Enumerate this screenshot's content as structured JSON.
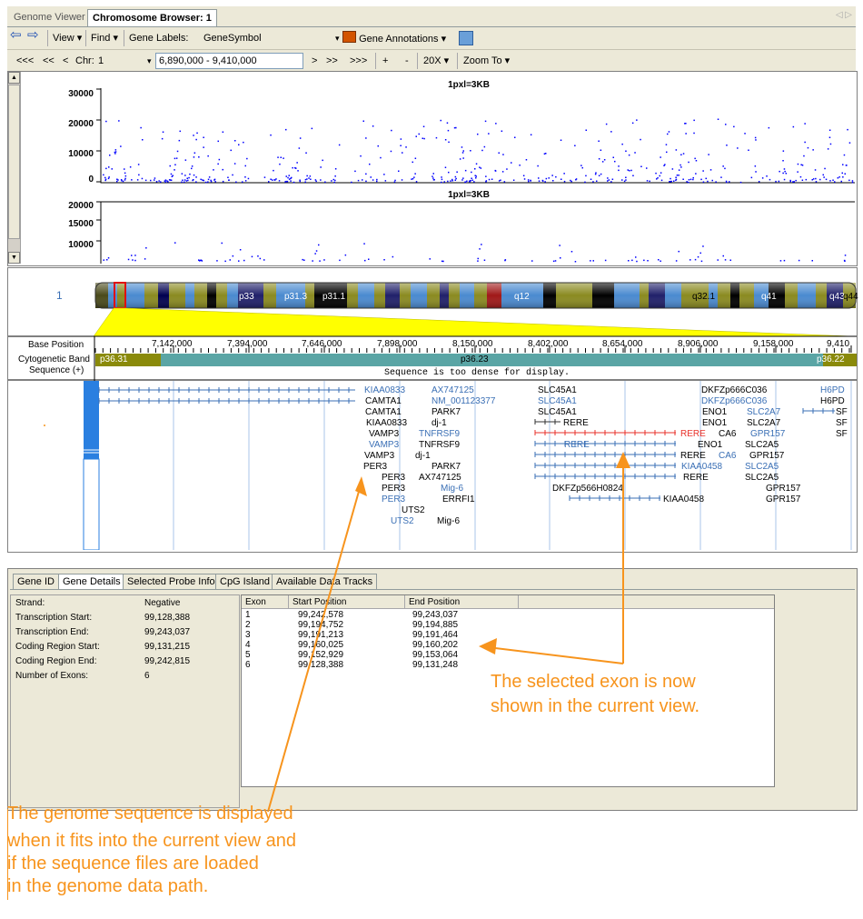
{
  "tabs": [
    {
      "label": "Genome Viewer",
      "active": false
    },
    {
      "label": "Chromosome Browser: 1",
      "active": true
    }
  ],
  "toolbar1": {
    "view": "View",
    "find": "Find",
    "gene_labels_label": "Gene Labels:",
    "gene_labels_value": "GeneSymbol",
    "gene_annotations": "Gene Annotations"
  },
  "toolbar2": {
    "nav_far_left": "<<<",
    "nav_left2": "<<",
    "nav_left": "<",
    "chr_label": "Chr:",
    "chr_value": "1",
    "range": "6,890,000 - 9,410,000",
    "nav_right": ">",
    "nav_right2": ">>",
    "nav_far_right": ">>>",
    "zoom_in": "+",
    "zoom_out": "-",
    "zoom_level": "20X",
    "zoom_to": "Zoom To"
  },
  "plot1": {
    "title": "1pxl=3KB",
    "ticks": [
      "30000",
      "20000",
      "10000",
      "0"
    ]
  },
  "plot2": {
    "title": "1pxl=3KB",
    "ticks": [
      "20000",
      "15000",
      "10000"
    ]
  },
  "chromosome": {
    "number": "1",
    "bands": [
      "p33",
      "p31.3",
      "p31.1",
      "q12",
      "q32.1",
      "q41",
      "q43",
      "q44"
    ]
  },
  "tracks": {
    "base_position": "Base Position",
    "cytogenetic_band": "Cytogenetic Band",
    "sequence": "Sequence (+)",
    "positions": [
      "7,142,000",
      "7,394,000",
      "7,646,000",
      "7,898,000",
      "8,150,000",
      "8,402,000",
      "8,654,000",
      "8,906,000",
      "9,158,000",
      "9,410"
    ],
    "cyto_bands": [
      "p36.31",
      "p36.23",
      "p36.22"
    ],
    "sequence_message": "Sequence is too dense for display."
  },
  "genes": [
    {
      "label": "KIAA0833",
      "color": "blue"
    },
    {
      "label": "CAMTA1",
      "color": "black"
    },
    {
      "label": "CAMTA1",
      "color": "black"
    },
    {
      "label": "KIAA0833",
      "color": "black"
    },
    {
      "label": "VAMP3",
      "color": "black"
    },
    {
      "label": "VAMP3",
      "color": "blue"
    },
    {
      "label": "VAMP3",
      "color": "black"
    },
    {
      "label": "PER3",
      "color": "black"
    },
    {
      "label": "PER3",
      "color": "black"
    },
    {
      "label": "PER3",
      "color": "black"
    },
    {
      "label": "PER3",
      "color": "blue"
    },
    {
      "label": "UTS2",
      "color": "black"
    },
    {
      "label": "UTS2",
      "color": "blue"
    },
    {
      "label": "AX747125",
      "color": "blue"
    },
    {
      "label": "NM_001123377",
      "color": "blue"
    },
    {
      "label": "PARK7",
      "color": "black"
    },
    {
      "label": "dj-1",
      "color": "black"
    },
    {
      "label": "TNFRSF9",
      "color": "blue"
    },
    {
      "label": "TNFRSF9",
      "color": "black"
    },
    {
      "label": "dj-1",
      "color": "black"
    },
    {
      "label": "PARK7",
      "color": "black"
    },
    {
      "label": "AX747125",
      "color": "black"
    },
    {
      "label": "Mig-6",
      "color": "blue"
    },
    {
      "label": "ERRFI1",
      "color": "black"
    },
    {
      "label": "Mig-6",
      "color": "black"
    },
    {
      "label": "SLC45A1",
      "color": "black"
    },
    {
      "label": "SLC45A1",
      "color": "blue"
    },
    {
      "label": "SLC45A1",
      "color": "black"
    },
    {
      "label": "RERE",
      "color": "black"
    },
    {
      "label": "RERE",
      "color": "red"
    },
    {
      "label": "RERE",
      "color": "blue"
    },
    {
      "label": "RERE",
      "color": "black"
    },
    {
      "label": "KIAA0458",
      "color": "blue"
    },
    {
      "label": "RERE",
      "color": "black"
    },
    {
      "label": "DKFZp566H0824",
      "color": "black"
    },
    {
      "label": "KIAA0458",
      "color": "black"
    },
    {
      "label": "DKFZp666C036",
      "color": "black"
    },
    {
      "label": "DKFZp666C036",
      "color": "blue"
    },
    {
      "label": "ENO1",
      "color": "black"
    },
    {
      "label": "ENO1",
      "color": "black"
    },
    {
      "label": "ENO1",
      "color": "black"
    },
    {
      "label": "SLC2A7",
      "color": "blue"
    },
    {
      "label": "SLC2A7",
      "color": "black"
    },
    {
      "label": "CA6",
      "color": "black"
    },
    {
      "label": "GPR157",
      "color": "blue"
    },
    {
      "label": "SLC2A5",
      "color": "black"
    },
    {
      "label": "CA6",
      "color": "blue"
    },
    {
      "label": "GPR157",
      "color": "black"
    },
    {
      "label": "SLC2A5",
      "color": "blue"
    },
    {
      "label": "SLC2A5",
      "color": "black"
    },
    {
      "label": "GPR157",
      "color": "black"
    },
    {
      "label": "GPR157",
      "color": "black"
    },
    {
      "label": "H6PD",
      "color": "blue"
    },
    {
      "label": "H6PD",
      "color": "black"
    },
    {
      "label": "SF",
      "color": "black"
    },
    {
      "label": "SF",
      "color": "black"
    },
    {
      "label": "SF",
      "color": "black"
    }
  ],
  "bottom_tabs": [
    "Gene ID",
    "Gene Details",
    "Selected Probe Info",
    "CpG Island",
    "Available Data Tracks"
  ],
  "details": [
    {
      "label": "Strand:",
      "value": "Negative"
    },
    {
      "label": "Transcription Start:",
      "value": "99,128,388"
    },
    {
      "label": "Transcription End:",
      "value": "99,243,037"
    },
    {
      "label": "Coding Region Start:",
      "value": "99,131,215"
    },
    {
      "label": "Coding Region End:",
      "value": "99,242,815"
    },
    {
      "label": "Number of Exons:",
      "value": "6"
    }
  ],
  "exon_table": {
    "headers": [
      "Exon",
      "Start Position",
      "End Position"
    ],
    "rows": [
      [
        "1",
        "99,242,578",
        "99,243,037"
      ],
      [
        "2",
        "99,194,752",
        "99,194,885"
      ],
      [
        "3",
        "99,191,213",
        "99,191,464"
      ],
      [
        "4",
        "99,160,025",
        "99,160,202"
      ],
      [
        "5",
        "99,152,929",
        "99,153,064"
      ],
      [
        "6",
        "99,128,388",
        "99,131,248"
      ]
    ]
  },
  "annotations": {
    "exon_line1": "The selected exon is now",
    "exon_line2": "shown in the current view.",
    "seq_line1": "The genome sequence is displayed",
    "seq_line2": "when it fits into the current view and",
    "seq_line3": "if the sequence files are loaded",
    "seq_line4": "in the genome data path."
  },
  "colors": {
    "annotation": "#f7941d",
    "plot_points": "#0000ff",
    "selected_gene": "#e8312a"
  }
}
